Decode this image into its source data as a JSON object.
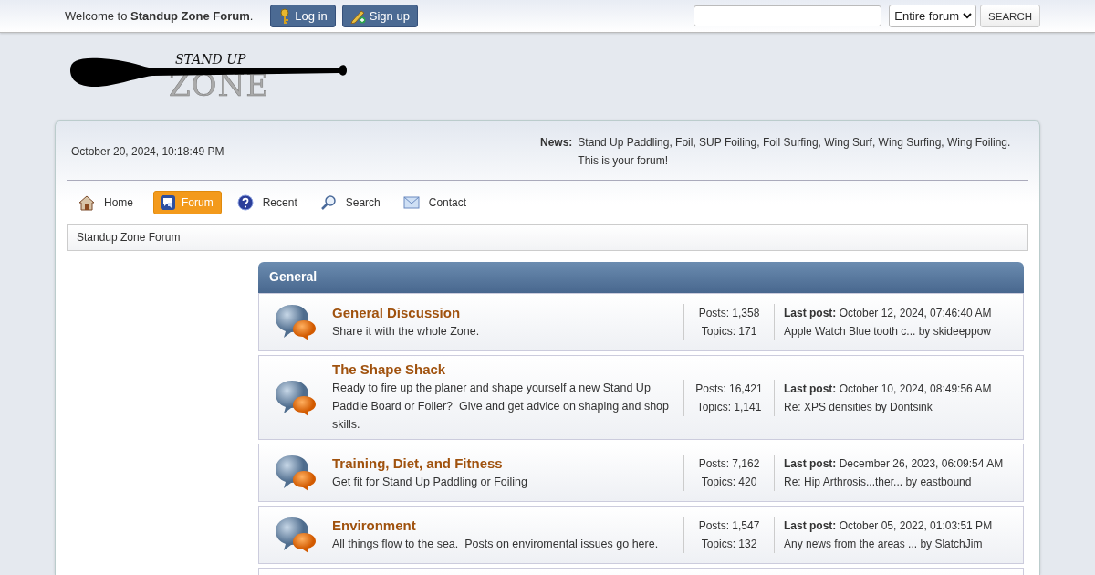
{
  "top_bar": {
    "welcome": "Welcome to **Standup Zone Forum**.",
    "buttons": [
      {
        "label": "Log in"
      },
      {
        "label": "Sign up"
      }
    ],
    "search": {
      "scope": "Entire forum",
      "button": "SEARCH"
    }
  },
  "logo": {
    "line_1": "STAND UP",
    "line_2": "ZONE"
  },
  "header": {
    "date": "October 20, 2024, 10:18:49 PM",
    "news_label": "News:",
    "news": "Stand Up Paddling, Foil, SUP Foiling, Foil Surfing, Wing Surf, Wing Surfing, Wing Foiling. This is your forum!"
  },
  "nav": [
    {
      "label": "Home",
      "selected": false
    },
    {
      "label": "Forum",
      "selected": true
    },
    {
      "label": "Recent",
      "selected": false
    },
    {
      "label": "Search",
      "selected": false
    },
    {
      "label": "Contact",
      "selected": false
    }
  ],
  "breadcrumb": "Standup Zone Forum",
  "category": {
    "title": "General",
    "boards": [
      {
        "name": "General Discussion",
        "description": "Share it with the whole Zone.",
        "posts": "Posts: 1,358",
        "topics": "Topics: 171",
        "last_post": "**Last post:** October 12, 2024, 07:46:40 AM",
        "last_topic": "Apple Watch Blue tooth c... by skideeppow"
      },
      {
        "name": "The Shape Shack",
        "description": "Ready to fire up the planer and shape yourself a new Stand Up Paddle Board or Foiler?  Give and get advice on shaping and shop skills.",
        "posts": "Posts: 16,421",
        "topics": "Topics: 1,141",
        "last_post": "**Last post:** October 10, 2024, 08:49:56 AM",
        "last_topic": "Re: XPS densities by Dontsink"
      },
      {
        "name": "Training, Diet, and Fitness",
        "description": "Get fit for Stand Up Paddling or Foiling",
        "posts": "Posts: 7,162",
        "topics": "Topics: 420",
        "last_post": "**Last post:** December 26, 2023, 06:09:54 AM",
        "last_topic": "Re: Hip Arthrosis...ther... by eastbound"
      },
      {
        "name": "Environment",
        "description": "All things flow to the sea.  Posts on enviromental issues go here.",
        "posts": "Posts: 1,547",
        "topics": "Topics: 132",
        "last_post": "**Last post:** October 05, 2022, 01:03:51 PM",
        "last_topic": "Any news from the areas ... by SlatchJim"
      }
    ]
  }
}
